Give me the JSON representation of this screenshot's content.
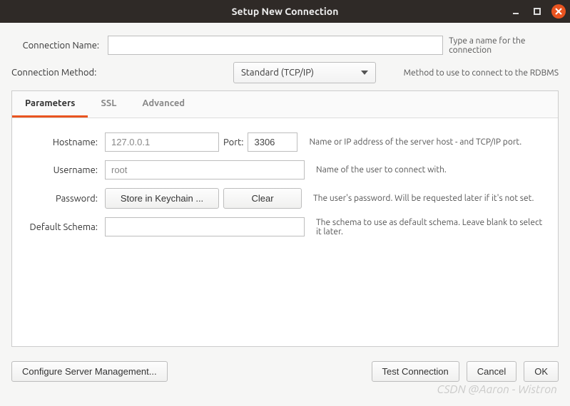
{
  "window": {
    "title": "Setup New Connection"
  },
  "top": {
    "conn_name_label": "Connection Name:",
    "conn_name_value": "",
    "conn_name_hint": "Type a name for the connection",
    "conn_method_label": "Connection Method:",
    "conn_method_value": "Standard (TCP/IP)",
    "conn_method_hint": "Method to use to connect to the RDBMS"
  },
  "tabs": {
    "parameters": "Parameters",
    "ssl": "SSL",
    "advanced": "Advanced"
  },
  "params": {
    "hostname_label": "Hostname:",
    "hostname_placeholder": "127.0.0.1",
    "port_label": "Port:",
    "port_value": "3306",
    "host_help": "Name or IP address of the server host - and TCP/IP port.",
    "username_label": "Username:",
    "username_placeholder": "root",
    "username_help": "Name of the user to connect with.",
    "password_label": "Password:",
    "store_keychain": "Store in Keychain ...",
    "clear": "Clear",
    "password_help": "The user's password. Will be requested later if it's not set.",
    "schema_label": "Default Schema:",
    "schema_value": "",
    "schema_help": "The schema to use as default schema. Leave blank to select it later."
  },
  "footer": {
    "configure": "Configure Server Management...",
    "test": "Test Connection",
    "cancel": "Cancel",
    "ok": "OK"
  },
  "watermark": "CSDN @Aaron - Wistron"
}
